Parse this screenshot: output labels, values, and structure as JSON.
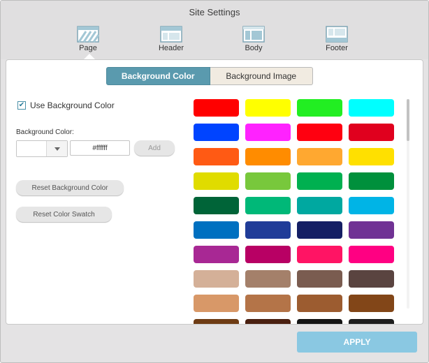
{
  "title": "Site Settings",
  "sections": [
    {
      "label": "Page",
      "icon": "page-icon"
    },
    {
      "label": "Header",
      "icon": "header-icon"
    },
    {
      "label": "Body",
      "icon": "body-icon"
    },
    {
      "label": "Footer",
      "icon": "footer-icon"
    }
  ],
  "tabs": [
    {
      "label": "Background Color",
      "active": true
    },
    {
      "label": "Background Image",
      "active": false
    }
  ],
  "settings": {
    "use_bg_label": "Use Background Color",
    "use_bg_checked": true,
    "checkmark": "✔",
    "bg_color_label": "Background Color:",
    "hex_value": "#ffffff",
    "add_label": "Add",
    "reset_bg_label": "Reset Background Color",
    "reset_swatch_label": "Reset Color Swatch"
  },
  "swatches": [
    "#ff0000",
    "#ffff00",
    "#22ee22",
    "#00ffff",
    "#0044ff",
    "#ff22ff",
    "#ff0010",
    "#e0001e",
    "#ff5a14",
    "#ff8c00",
    "#ffa830",
    "#ffe000",
    "#e0dc00",
    "#78c83c",
    "#00b050",
    "#00903c",
    "#006438",
    "#00b878",
    "#00a8a0",
    "#00b4e6",
    "#0070c0",
    "#203c98",
    "#141e64",
    "#703294",
    "#a82894",
    "#b80064",
    "#ff1464",
    "#ff0082",
    "#d4b098",
    "#a4806a",
    "#7a5c50",
    "#5a4440",
    "#d89868",
    "#b47448",
    "#9c5c30",
    "#824618",
    "#6e3c14",
    "#4a2010",
    "#141414",
    "#1e1e1e"
  ],
  "apply_label": "APPLY",
  "colors": {
    "tab_active": "#5a9aae",
    "tab_inactive": "#f1ebe1",
    "apply_button": "#8ac8e2",
    "window_bg": "#e4e3e4"
  }
}
